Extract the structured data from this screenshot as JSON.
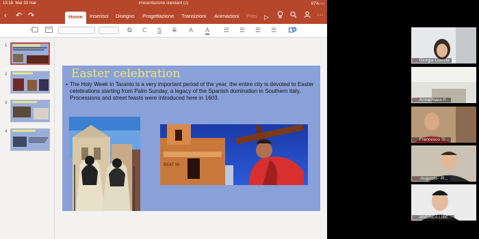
{
  "status_bar": {
    "time": "13:18",
    "date": "Mar 30 mar",
    "document_title": "Presentazione standard (2)",
    "battery": "87%"
  },
  "ribbon": {
    "tabs": [
      {
        "label": "Home",
        "active": true
      },
      {
        "label": "Inserisci"
      },
      {
        "label": "Disegno"
      },
      {
        "label": "Progettazione"
      },
      {
        "label": "Transizioni"
      },
      {
        "label": "Animazioni"
      },
      {
        "label": "Pres"
      }
    ],
    "icons": [
      "back-icon",
      "undo-icon",
      "redo-icon",
      "play-icon",
      "lightbulb-icon",
      "search-icon",
      "share-icon",
      "more-icon"
    ]
  },
  "toolbar": {
    "bold": "G",
    "italic": "C",
    "underline": "S",
    "strike": "S",
    "font_size_letter": "A",
    "font_color_letter": "A"
  },
  "thumbnails": [
    {
      "number": "1",
      "selected": true
    },
    {
      "number": "2"
    },
    {
      "number": "3"
    },
    {
      "number": "4"
    }
  ],
  "slide": {
    "title": "Easter celebration",
    "bullet": "•",
    "body": "The Holy Week in Taranto is a very important period of the year, the entire city is devoted to Easter celebrations starting from Palm Sunday, a legacy of the Spanish domination in Southern Italy. Processions and street feasts were introduced here in 1603.",
    "sign_text": "BEAT NI"
  },
  "participants": [
    {
      "name": "Giorgia Ciaccia"
    },
    {
      "name": "Annachiara P..."
    },
    {
      "name": "Francesco Si..."
    },
    {
      "name": "-Augusto- -R..."
    },
    {
      "name": "ANDREA LIBE..."
    }
  ],
  "colors": {
    "accent": "#b7472a",
    "slide_bg": "#8aa0d8",
    "slide_title": "#ecea6a",
    "mic_muted": "#e04040"
  }
}
